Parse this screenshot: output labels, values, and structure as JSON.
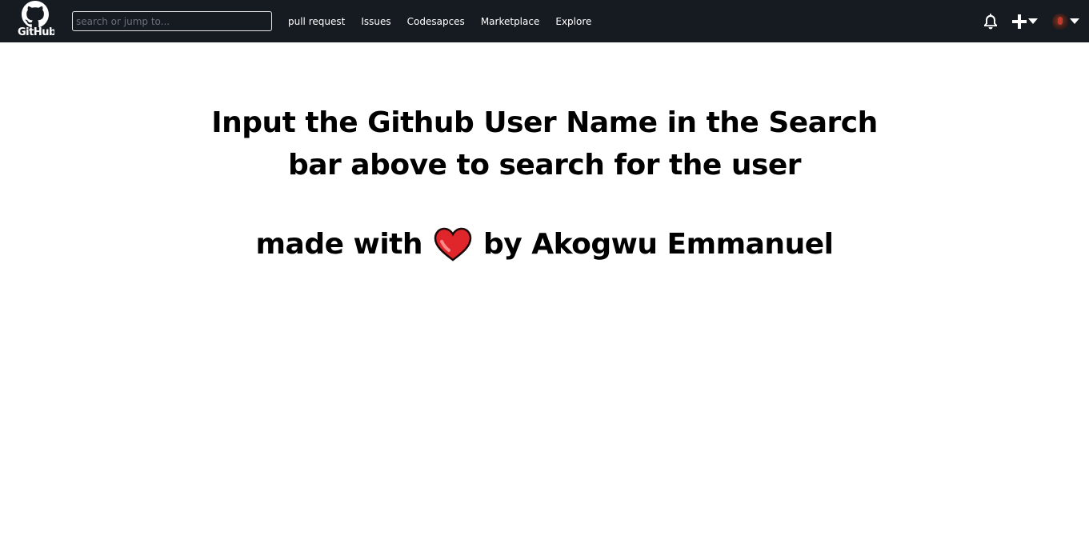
{
  "header": {
    "logo_wordmark": "GitHub",
    "search_placeholder": "search or jump to...",
    "nav": [
      {
        "label": "pull request"
      },
      {
        "label": "Issues"
      },
      {
        "label": "Codesapces"
      },
      {
        "label": "Marketplace"
      },
      {
        "label": "Explore"
      }
    ],
    "icons": [
      "bell-icon",
      "plus-icon",
      "avatar"
    ]
  },
  "main": {
    "headline": "Input the Github User Name in the Search bar above to search for the user",
    "credit_prefix": "made with",
    "credit_suffix": "by Akogwu Emmanuel",
    "heart_icon": "heart-icon"
  },
  "colors": {
    "topbar": "#161b22",
    "heart": "#e0262b"
  }
}
